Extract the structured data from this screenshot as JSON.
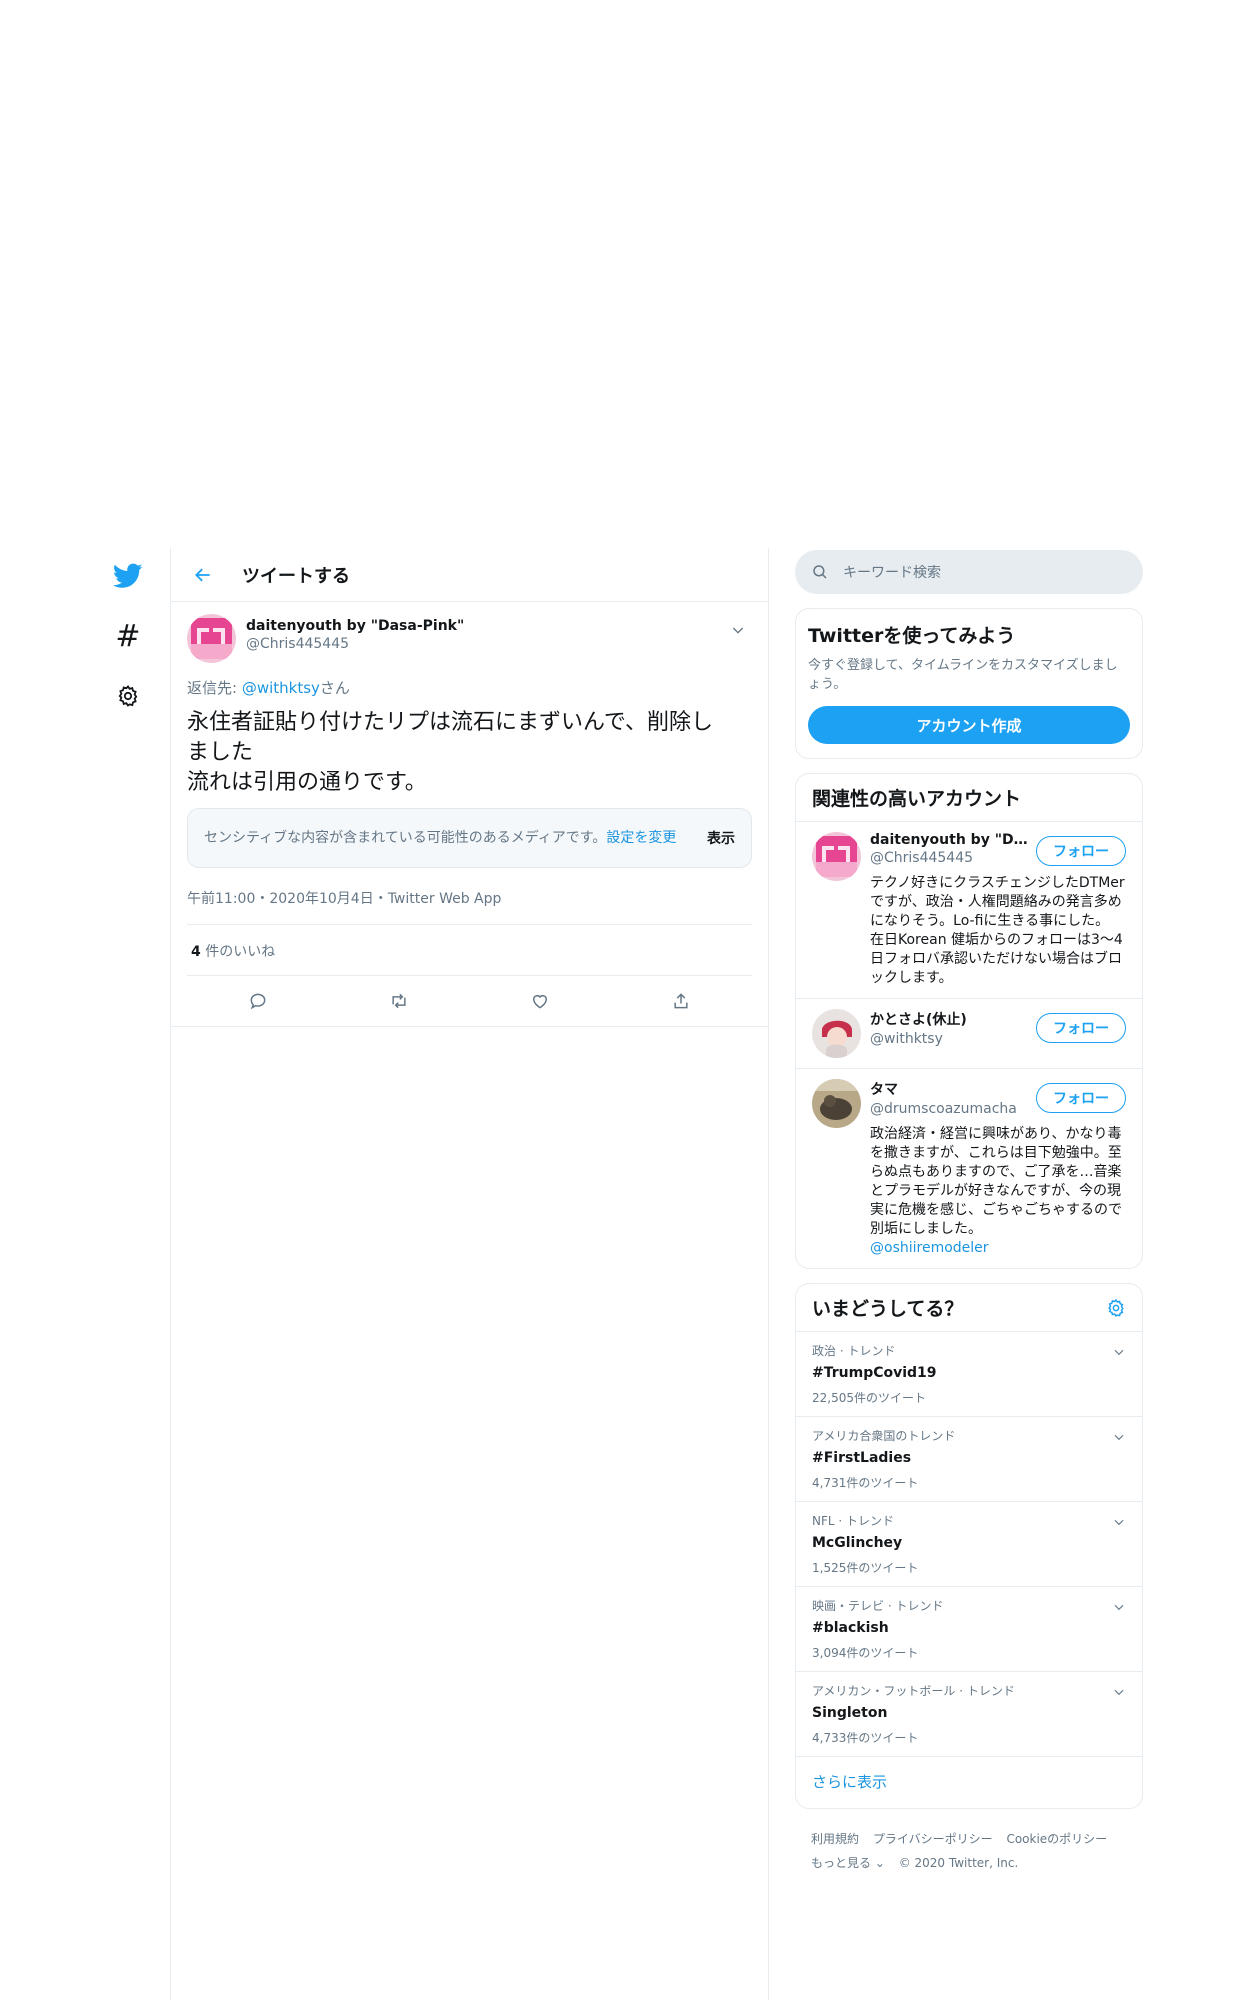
{
  "nav": {
    "icons": [
      "twitter-bird-icon",
      "hashtag-icon",
      "gear-icon"
    ]
  },
  "header": {
    "title": "ツイートする"
  },
  "tweet": {
    "user_name": "daitenyouth by \"Dasa-Pink\"",
    "user_handle": "@Chris445445",
    "reply_prefix": "返信先: ",
    "reply_handle": "@withktsy",
    "reply_suffix": "さん",
    "text_line1": "永住者証貼り付けたリプは流石にまずいんで、削除し",
    "text_line2": "ました",
    "text_line3": "流れは引用の通りです。",
    "sensitive_text": "センシティブな内容が含まれている可能性のあるメディアです。",
    "sensitive_link": "設定を変更",
    "sensitive_show": "表示",
    "meta": "午前11:00・2020年10月4日・Twitter Web App",
    "likes_count": "4",
    "likes_label": " 件のいいね"
  },
  "search": {
    "placeholder": "キーワード検索"
  },
  "signup": {
    "title": "Twitterを使ってみよう",
    "subtitle": "今すぐ登録して、タイムラインをカスタマイズしましょう。",
    "button": "アカウント作成"
  },
  "related": {
    "title": "関連性の高いアカウント",
    "follow_label": "フォロー",
    "accounts": [
      {
        "name": "daitenyouth by \"Dasa...",
        "handle": "@Chris445445",
        "bio": "テクノ好きにクラスチェンジしたDTMerですが、政治・人権問題絡みの発言多めになりそう。Lo-fiに生きる事にした。 在日Korean 健垢からのフォローは3～4日フォロバ承認いただけない場合はブロックします。",
        "bio_link": ""
      },
      {
        "name": "かとさよ(休止)",
        "handle": "@withktsy",
        "bio": "",
        "bio_link": ""
      },
      {
        "name": "タマ",
        "handle": "@drumscoazumacha",
        "bio": "政治経済・経営に興味があり、かなり毒を撒きますが、これらは目下勉強中。至らぬ点もありますので、ご了承を…音楽とプラモデルが好きなんですが、今の現実に危機を感じ、ごちゃごちゃするので別垢にしました。",
        "bio_link": "@oshiiremodeler"
      }
    ]
  },
  "trends": {
    "title": "いまどうしてる？",
    "items": [
      {
        "context": "政治 · トレンド",
        "name": "#TrumpCovid19",
        "count": "22,505件のツイート"
      },
      {
        "context": "アメリカ合衆国のトレンド",
        "name": "#FirstLadies",
        "count": "4,731件のツイート"
      },
      {
        "context": "NFL · トレンド",
        "name": "McGlinchey",
        "count": "1,525件のツイート"
      },
      {
        "context": "映画・テレビ · トレンド",
        "name": "#blackish",
        "count": "3,094件のツイート"
      },
      {
        "context": "アメリカン・フットボール · トレンド",
        "name": "Singleton",
        "count": "4,733件のツイート"
      }
    ],
    "show_more": "さらに表示"
  },
  "footer": {
    "terms": "利用規約",
    "privacy": "プライバシーポリシー",
    "cookie": "Cookieのポリシー",
    "more": "もっと見る ⌄",
    "copyright": "© 2020 Twitter, Inc."
  },
  "colors": {
    "accent": "#1da1f2",
    "link": "#1b95e0",
    "secondary_text": "#657786",
    "border": "#e6ecf0"
  }
}
